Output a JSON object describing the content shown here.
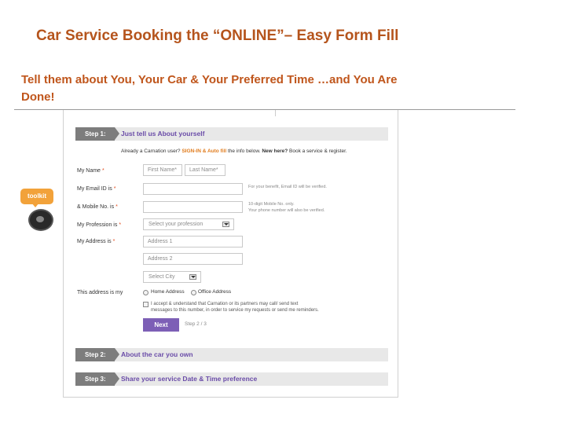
{
  "slide": {
    "title": "Car Service Booking the “ONLINE”– Easy Form Fill",
    "subtitle": "Tell them about You, Your Car & Your Preferred Time …and You Are Done!"
  },
  "toolkit": {
    "label": "toolkit"
  },
  "steps": [
    {
      "label": "Step 1:",
      "title": "Just tell us About yourself"
    },
    {
      "label": "Step 2:",
      "title": "About the car you own"
    },
    {
      "label": "Step 3:",
      "title": "Share your service Date & Time preference"
    }
  ],
  "intro": {
    "already": "Already a Carnation user?",
    "signin": "SIGN-IN & Auto fill",
    "middle": "the info below.",
    "new_here": "New here?",
    "book": "Book a service & register."
  },
  "form": {
    "name_label": "My Name",
    "first_name_placeholder": "First Name*",
    "last_name_placeholder": "Last Name*",
    "email_label": "My Email ID is",
    "email_hint": "For your benefit, Email ID will be verified.",
    "mobile_label": "& Mobile No. is",
    "mobile_hint_1": "10-digit Mobile No. only.",
    "mobile_hint_2": "Your phone number will also be verified.",
    "profession_label": "My Profession is",
    "profession_select": "Select your profession",
    "address_label": "My Address is",
    "address1_placeholder": "Address 1",
    "address2_placeholder": "Address 2",
    "city_select": "Select City",
    "address_type_label": "This address is my",
    "address_type_options": [
      "Home Address",
      "Office Address"
    ],
    "agree_line1": "I accept & understand that Carnation or its partners may call/ send text",
    "agree_line2": "messages to this number, in order to service my requests or send me reminders.",
    "next_button": "Next",
    "step_count": "Step 2 / 3",
    "required_mark": "*"
  },
  "colors": {
    "title": "#b5541c",
    "subtitle": "#c0561c",
    "step_title": "#6a4ca8",
    "next_button": "#7d5fb6",
    "step_label_bg": "#7d7d7d"
  }
}
